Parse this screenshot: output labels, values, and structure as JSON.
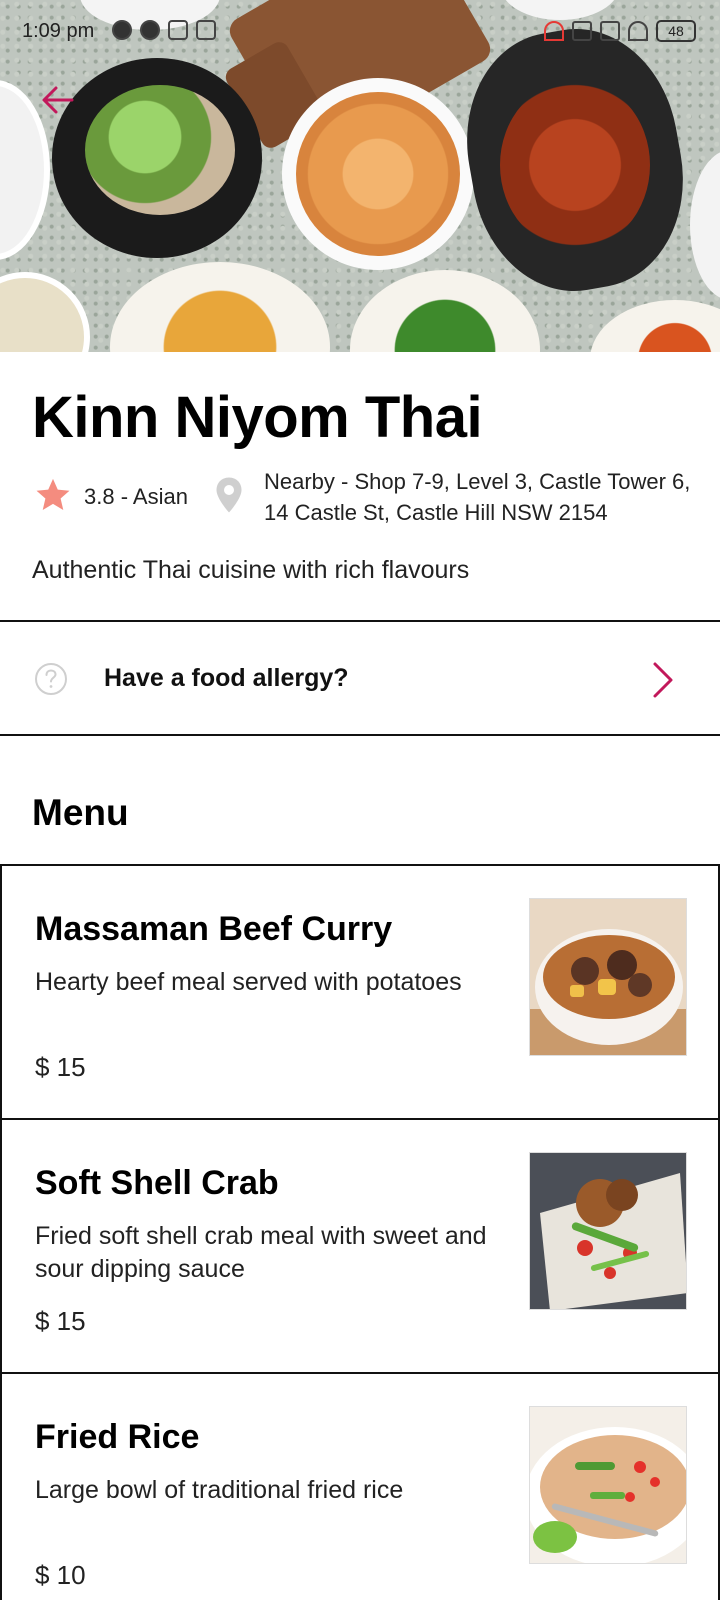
{
  "status_bar": {
    "time": "1:09 pm",
    "battery": "48"
  },
  "restaurant": {
    "name": "Kinn Niyom Thai",
    "rating_cuisine": "3.8 - Asian",
    "address_line1": "Nearby - Shop 7-9, Level 3, Castle Tower 6,",
    "address_line2": "14 Castle St, Castle Hill NSW 2154",
    "description": "Authentic Thai cuisine with rich flavours"
  },
  "allergy": {
    "label": "Have a food allergy?"
  },
  "menu": {
    "heading": "Menu",
    "items": [
      {
        "name": "Massaman Beef Curry",
        "description": "Hearty beef meal served with potatoes",
        "price": "$ 15"
      },
      {
        "name": "Soft Shell Crab",
        "description": "Fried soft shell crab meal with sweet and sour dipping sauce",
        "price": "$ 15"
      },
      {
        "name": "Fried Rice",
        "description": "Large bowl of traditional fried rice",
        "price": "$ 10"
      }
    ]
  },
  "colors": {
    "accent": "#c2185b",
    "star": "#f48c7f",
    "pin": "#cfcfcf",
    "divider": "#111111"
  }
}
